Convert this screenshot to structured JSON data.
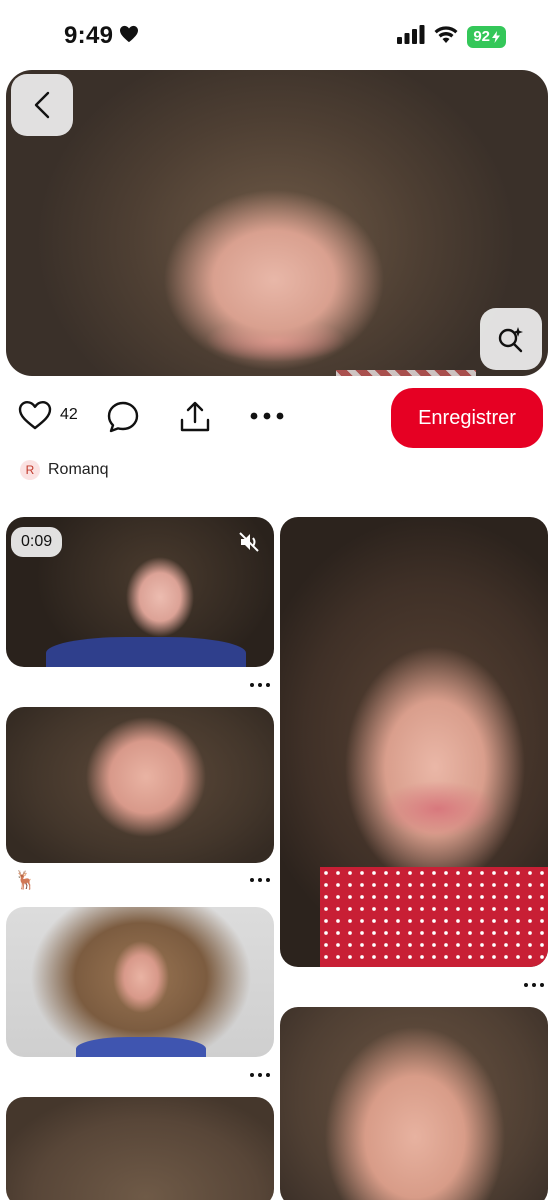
{
  "status_bar": {
    "time": "9:49",
    "battery": "92",
    "icons": [
      "heart-icon",
      "signal-icon",
      "wifi-icon",
      "battery-charging-icon"
    ]
  },
  "pin": {
    "likes": "42",
    "save_label": "Enregistrer",
    "creator_initial": "R",
    "creator_name": "Romanq"
  },
  "grid": {
    "video_duration": "0:09",
    "pin_emoji": "🦌"
  },
  "colors": {
    "accent": "#e60023",
    "battery": "#34c759"
  }
}
